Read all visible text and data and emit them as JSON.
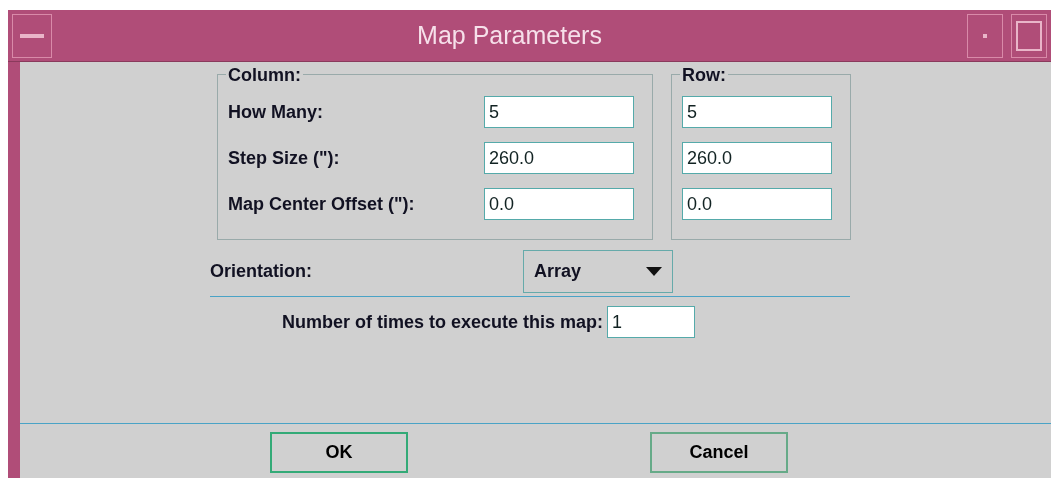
{
  "window": {
    "title": "Map Parameters"
  },
  "column": {
    "legend": "Column:",
    "fields": [
      {
        "label": "How Many:",
        "value": "5"
      },
      {
        "label": "Step Size (\"):",
        "value": "260.0"
      },
      {
        "label": "Map Center Offset (\"):",
        "value": "0.0"
      }
    ]
  },
  "row": {
    "legend": "Row:",
    "fields": [
      {
        "value": "5"
      },
      {
        "value": "260.0"
      },
      {
        "value": "0.0"
      }
    ]
  },
  "orientation": {
    "label": "Orientation:",
    "value": "Array"
  },
  "repeat": {
    "label": "Number of times to execute this map:",
    "value": "1"
  },
  "buttons": [
    "OK",
    "Cancel"
  ]
}
